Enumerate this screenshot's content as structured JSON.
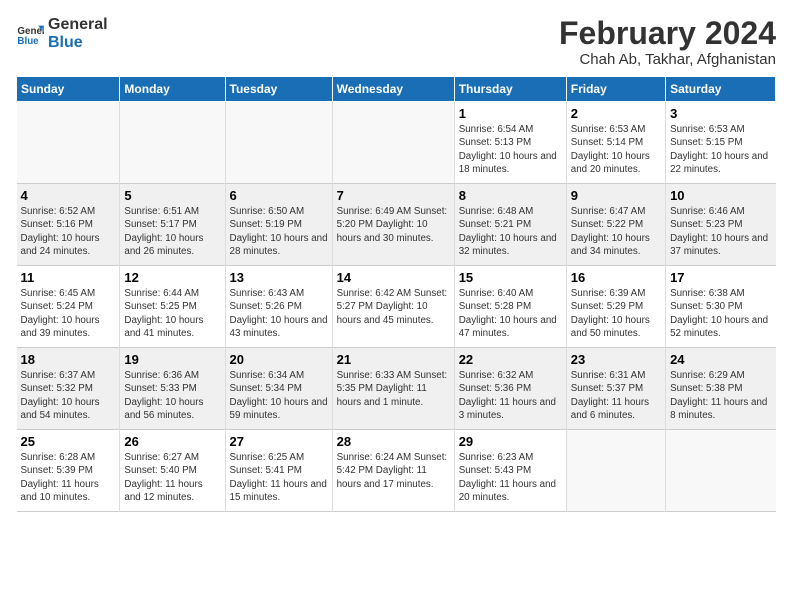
{
  "logo": {
    "line1": "General",
    "line2": "Blue"
  },
  "title": "February 2024",
  "subtitle": "Chah Ab, Takhar, Afghanistan",
  "days_of_week": [
    "Sunday",
    "Monday",
    "Tuesday",
    "Wednesday",
    "Thursday",
    "Friday",
    "Saturday"
  ],
  "weeks": [
    [
      {
        "day": "",
        "info": ""
      },
      {
        "day": "",
        "info": ""
      },
      {
        "day": "",
        "info": ""
      },
      {
        "day": "",
        "info": ""
      },
      {
        "day": "1",
        "info": "Sunrise: 6:54 AM\nSunset: 5:13 PM\nDaylight: 10 hours\nand 18 minutes."
      },
      {
        "day": "2",
        "info": "Sunrise: 6:53 AM\nSunset: 5:14 PM\nDaylight: 10 hours\nand 20 minutes."
      },
      {
        "day": "3",
        "info": "Sunrise: 6:53 AM\nSunset: 5:15 PM\nDaylight: 10 hours\nand 22 minutes."
      }
    ],
    [
      {
        "day": "4",
        "info": "Sunrise: 6:52 AM\nSunset: 5:16 PM\nDaylight: 10 hours\nand 24 minutes."
      },
      {
        "day": "5",
        "info": "Sunrise: 6:51 AM\nSunset: 5:17 PM\nDaylight: 10 hours\nand 26 minutes."
      },
      {
        "day": "6",
        "info": "Sunrise: 6:50 AM\nSunset: 5:19 PM\nDaylight: 10 hours\nand 28 minutes."
      },
      {
        "day": "7",
        "info": "Sunrise: 6:49 AM\nSunset: 5:20 PM\nDaylight: 10 hours\nand 30 minutes."
      },
      {
        "day": "8",
        "info": "Sunrise: 6:48 AM\nSunset: 5:21 PM\nDaylight: 10 hours\nand 32 minutes."
      },
      {
        "day": "9",
        "info": "Sunrise: 6:47 AM\nSunset: 5:22 PM\nDaylight: 10 hours\nand 34 minutes."
      },
      {
        "day": "10",
        "info": "Sunrise: 6:46 AM\nSunset: 5:23 PM\nDaylight: 10 hours\nand 37 minutes."
      }
    ],
    [
      {
        "day": "11",
        "info": "Sunrise: 6:45 AM\nSunset: 5:24 PM\nDaylight: 10 hours\nand 39 minutes."
      },
      {
        "day": "12",
        "info": "Sunrise: 6:44 AM\nSunset: 5:25 PM\nDaylight: 10 hours\nand 41 minutes."
      },
      {
        "day": "13",
        "info": "Sunrise: 6:43 AM\nSunset: 5:26 PM\nDaylight: 10 hours\nand 43 minutes."
      },
      {
        "day": "14",
        "info": "Sunrise: 6:42 AM\nSunset: 5:27 PM\nDaylight: 10 hours\nand 45 minutes."
      },
      {
        "day": "15",
        "info": "Sunrise: 6:40 AM\nSunset: 5:28 PM\nDaylight: 10 hours\nand 47 minutes."
      },
      {
        "day": "16",
        "info": "Sunrise: 6:39 AM\nSunset: 5:29 PM\nDaylight: 10 hours\nand 50 minutes."
      },
      {
        "day": "17",
        "info": "Sunrise: 6:38 AM\nSunset: 5:30 PM\nDaylight: 10 hours\nand 52 minutes."
      }
    ],
    [
      {
        "day": "18",
        "info": "Sunrise: 6:37 AM\nSunset: 5:32 PM\nDaylight: 10 hours\nand 54 minutes."
      },
      {
        "day": "19",
        "info": "Sunrise: 6:36 AM\nSunset: 5:33 PM\nDaylight: 10 hours\nand 56 minutes."
      },
      {
        "day": "20",
        "info": "Sunrise: 6:34 AM\nSunset: 5:34 PM\nDaylight: 10 hours\nand 59 minutes."
      },
      {
        "day": "21",
        "info": "Sunrise: 6:33 AM\nSunset: 5:35 PM\nDaylight: 11 hours\nand 1 minute."
      },
      {
        "day": "22",
        "info": "Sunrise: 6:32 AM\nSunset: 5:36 PM\nDaylight: 11 hours\nand 3 minutes."
      },
      {
        "day": "23",
        "info": "Sunrise: 6:31 AM\nSunset: 5:37 PM\nDaylight: 11 hours\nand 6 minutes."
      },
      {
        "day": "24",
        "info": "Sunrise: 6:29 AM\nSunset: 5:38 PM\nDaylight: 11 hours\nand 8 minutes."
      }
    ],
    [
      {
        "day": "25",
        "info": "Sunrise: 6:28 AM\nSunset: 5:39 PM\nDaylight: 11 hours\nand 10 minutes."
      },
      {
        "day": "26",
        "info": "Sunrise: 6:27 AM\nSunset: 5:40 PM\nDaylight: 11 hours\nand 12 minutes."
      },
      {
        "day": "27",
        "info": "Sunrise: 6:25 AM\nSunset: 5:41 PM\nDaylight: 11 hours\nand 15 minutes."
      },
      {
        "day": "28",
        "info": "Sunrise: 6:24 AM\nSunset: 5:42 PM\nDaylight: 11 hours\nand 17 minutes."
      },
      {
        "day": "29",
        "info": "Sunrise: 6:23 AM\nSunset: 5:43 PM\nDaylight: 11 hours\nand 20 minutes."
      },
      {
        "day": "",
        "info": ""
      },
      {
        "day": "",
        "info": ""
      }
    ]
  ]
}
